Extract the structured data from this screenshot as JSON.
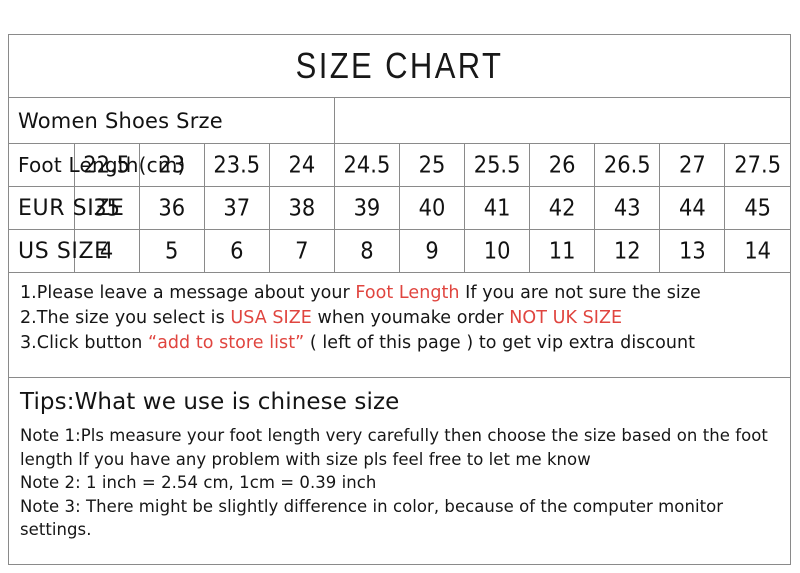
{
  "title": "SIZE CHART",
  "table": {
    "section_label": "Women Shoes Srze",
    "rows": [
      {
        "label": "Foot Length(cm)",
        "values": [
          "22.5",
          "23",
          "23.5",
          "24",
          "24.5",
          "25",
          "25.5",
          "26",
          "26.5",
          "27",
          "27.5"
        ]
      },
      {
        "label": "EUR SIZE",
        "values": [
          "35",
          "36",
          "37",
          "38",
          "39",
          "40",
          "41",
          "42",
          "43",
          "44",
          "45"
        ]
      },
      {
        "label": "US  SIZE",
        "values": [
          "4",
          "5",
          "6",
          "7",
          "8",
          "9",
          "10",
          "11",
          "12",
          "13",
          "14"
        ]
      }
    ]
  },
  "notes": {
    "line1": {
      "a": "1.Please leave a message about your ",
      "red": "Foot Length",
      "b": " If you are not sure the size"
    },
    "line2": {
      "a": "2.The size you select is ",
      "red1": "USA SIZE",
      "b": " when youmake order ",
      "red2": "NOT UK SIZE"
    },
    "line3": {
      "a": "3.Click button  ",
      "red": "“add to store list”",
      "b": "  ( left of this page ) to get vip extra discount"
    }
  },
  "tips": {
    "heading": "Tips:What we use is chinese size",
    "note1": "Note 1:Pls measure your foot length very carefully then choose the size based on the foot length lf you have any problem with size pls feel free to let me know",
    "note2": "Note 2: 1 inch = 2.54 cm, 1cm = 0.39 inch",
    "note3": "Note 3: There might be slightly difference in color, because of the computer monitor settings."
  },
  "colors": {
    "accent_red": "#e0453f",
    "border": "#8a8a8a",
    "text": "#161616",
    "background": "#ffffff"
  }
}
